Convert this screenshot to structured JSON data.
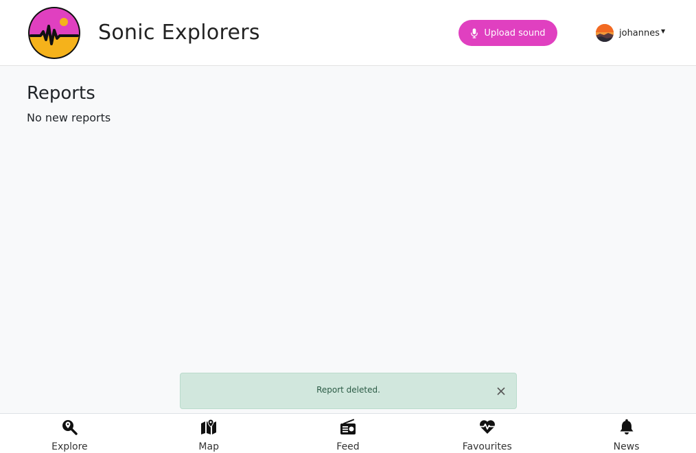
{
  "header": {
    "app_title": "Sonic Explorers",
    "upload_label": "Upload sound",
    "username": "johannes",
    "brand_color": "#e040c0"
  },
  "main": {
    "title": "Reports",
    "empty_message": "No new reports"
  },
  "toast": {
    "message": "Report deleted.",
    "type": "success"
  },
  "bottom_nav": {
    "items": [
      {
        "label": "Explore",
        "icon": "search-location-icon"
      },
      {
        "label": "Map",
        "icon": "map-icon"
      },
      {
        "label": "Feed",
        "icon": "radio-icon"
      },
      {
        "label": "Favourites",
        "icon": "heartbeat-icon"
      },
      {
        "label": "News",
        "icon": "bell-icon"
      }
    ]
  }
}
